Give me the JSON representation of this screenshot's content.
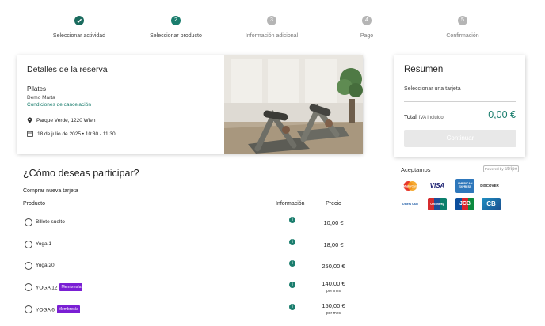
{
  "stepper": {
    "steps": [
      {
        "label": "Seleccionar actividad",
        "number": "1",
        "state": "done"
      },
      {
        "label": "Seleccionar producto",
        "number": "2",
        "state": "active"
      },
      {
        "label": "Información adicional",
        "number": "3",
        "state": "todo"
      },
      {
        "label": "Pago",
        "number": "4",
        "state": "todo"
      },
      {
        "label": "Confirmación",
        "number": "5",
        "state": "todo"
      }
    ]
  },
  "reservation": {
    "title": "Detalles de la reserva",
    "activity": "Pilates",
    "instructor": "Demo Marta",
    "cancel_link": "Condiciones de cancelación",
    "location": "Parque Verde, 1220 Wien",
    "datetime": "18 de julio de 2025 • 10:30 - 11:30"
  },
  "summary": {
    "title": "Resumen",
    "subtitle": "Seleccionar una tarjeta",
    "total_label": "Total",
    "tax_note": "IVA incluido",
    "total_value": "0,00 €",
    "continue_label": "Continuar"
  },
  "payments": {
    "accept_label": "Aceptamos",
    "stripe_prefix": "Powered by",
    "stripe_name": "stripe",
    "logos": [
      "MasterCard",
      "VISA",
      "AMERICAN EXPRESS",
      "DISCOVER",
      "Diners Club",
      "UnionPay",
      "JCB",
      "CB"
    ]
  },
  "participation": {
    "title": "¿Cómo deseas participar?",
    "subtitle": "Comprar nueva tarjeta",
    "columns": {
      "product": "Producto",
      "info": "Información",
      "price": "Precio"
    },
    "products": [
      {
        "name": "Billete suelto",
        "badge": "",
        "price": "10,00 €",
        "per": ""
      },
      {
        "name": "Yoga 1",
        "badge": "",
        "price": "18,00 €",
        "per": ""
      },
      {
        "name": "Yoga 20",
        "badge": "",
        "price": "250,00 €",
        "per": ""
      },
      {
        "name": "YOGA 12",
        "badge": "Membresía",
        "price": "140,00 €",
        "per": "por mes"
      },
      {
        "name": "YOGA 6",
        "badge": "Membresía",
        "price": "150,00 €",
        "per": "por mes"
      }
    ]
  },
  "colors": {
    "accent": "#1a7d6d",
    "badge": "#7a1fd4",
    "disabled_button": "#e8e8e8"
  }
}
